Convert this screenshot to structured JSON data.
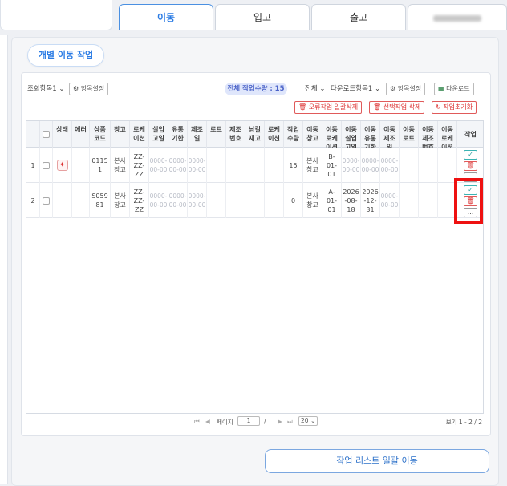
{
  "tabs": [
    {
      "label": "이동",
      "active": true
    },
    {
      "label": "입고"
    },
    {
      "label": "출고"
    },
    {
      "label": ""
    }
  ],
  "section_chip": "개별 이동 작업",
  "toolbar": {
    "query_select": "조회항목1",
    "query_settings": "항목설정",
    "total_badge": "전체 작업수량 : 15",
    "scope_select": "전체",
    "download_select": "다운로드항목1",
    "download_settings": "항목설정",
    "download_button": "다운로드",
    "delete_error_button": "오류작업 일괄삭제",
    "delete_selected_button": "선택작업 삭제",
    "reset_button": "작업초기화"
  },
  "columns": [
    "",
    "",
    "상태",
    "에러",
    "상품\n코드",
    "창고",
    "로케\n이션",
    "실입\n고일",
    "유통\n기한",
    "제조\n일",
    "로트",
    "제조\n번호",
    "남길\n재고\n…",
    "로케\n이션\n…",
    "작업\n수량",
    "이동\n창고",
    "이동\n로케\n이션",
    "이동\n실입\n고일",
    "이동\n유통\n기한",
    "이동\n제조\n일",
    "이동\n로트",
    "이동\n제조\n번호",
    "이동\n로케\n이션",
    "작업"
  ],
  "rows": [
    {
      "no": "1",
      "product_code": "0115\n1",
      "warehouse": "본사\n창고",
      "location": "ZZ-\nZZ-\nZZ",
      "in_date": "0000-\n00-00",
      "expiry": "0000-\n00-00",
      "mfg": "0000-\n00-00",
      "qty": "15",
      "move_wh": "본사\n창고",
      "move_loc": "B-\n01-\n01",
      "move_in": "0000-\n00-00",
      "move_exp": "0000-\n00-00",
      "move_mfg": "0000-\n00-00",
      "placeholder_style": true
    },
    {
      "no": "2",
      "product_code": "S059\n81",
      "warehouse": "본사\n창고",
      "location": "ZZ-\nZZ-\nZZ",
      "in_date": "0000-\n00-00",
      "expiry": "0000-\n00-00",
      "mfg": "0000-\n00-00",
      "qty": "0",
      "move_wh": "본사\n창고",
      "move_loc": "A-\n01-\n01",
      "move_in": "2026\n-08-\n18",
      "move_exp": "2026\n-12-\n31",
      "move_mfg": "0000-\n00-00",
      "placeholder_style": false
    }
  ],
  "pager": {
    "page_label": "페이지",
    "page": "1",
    "of": "/ 1",
    "per_page": "20",
    "summary": "보기 1 - 2 / 2"
  },
  "bulk_move_button": "작업 리스트 일괄 이동",
  "colors": {
    "accent": "#2a7be4",
    "danger": "#d33333",
    "highlight": "#ee1111"
  }
}
